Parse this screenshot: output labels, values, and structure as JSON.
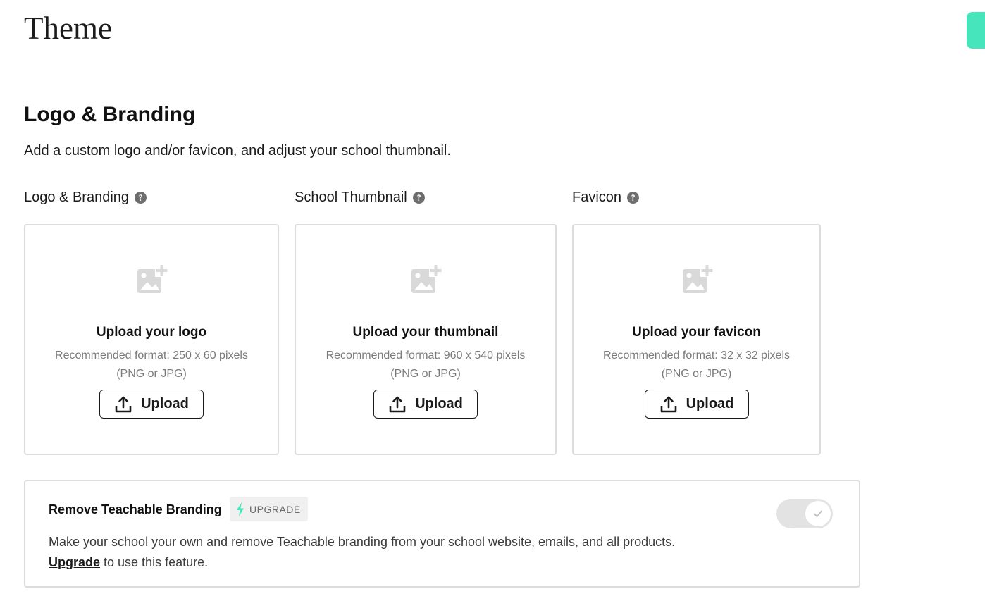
{
  "page": {
    "title": "Theme"
  },
  "section": {
    "title": "Logo & Branding",
    "description": "Add a custom logo and/or favicon, and adjust your school thumbnail."
  },
  "columns": [
    {
      "label": "Logo & Branding",
      "help_icon": "question-circle-icon",
      "card_title": "Upload your logo",
      "note_line1": "Recommended format: 250 x 60 pixels",
      "note_line2": "(PNG or JPG)",
      "button_label": "Upload"
    },
    {
      "label": "School Thumbnail",
      "help_icon": "question-circle-icon",
      "card_title": "Upload your thumbnail",
      "note_line1": "Recommended format: 960 x 540 pixels",
      "note_line2": "(PNG or JPG)",
      "button_label": "Upload"
    },
    {
      "label": "Favicon",
      "help_icon": "question-circle-icon",
      "card_title": "Upload your favicon",
      "note_line1": "Recommended format: 32 x 32 pixels",
      "note_line2": "(PNG or JPG)",
      "button_label": "Upload"
    }
  ],
  "branding": {
    "title": "Remove Teachable Branding",
    "badge_label": "UPGRADE",
    "badge_icon": "lightning-bolt-icon",
    "description": "Make your school your own and remove Teachable branding from your school website, emails, and all products.",
    "link_text": "Upgrade",
    "link_suffix": " to use this feature.",
    "toggle_state": "on-disabled"
  },
  "colors": {
    "accent": "#47e5bc",
    "border": "#dcdcdc",
    "muted_text": "#7a7a7a",
    "placeholder_icon": "#d9d9d9",
    "toggle_track": "#e3e3e3"
  },
  "icons": {
    "image_placeholder": "image-plus-icon",
    "upload": "upload-arrow-icon",
    "toggle_check": "check-icon"
  }
}
